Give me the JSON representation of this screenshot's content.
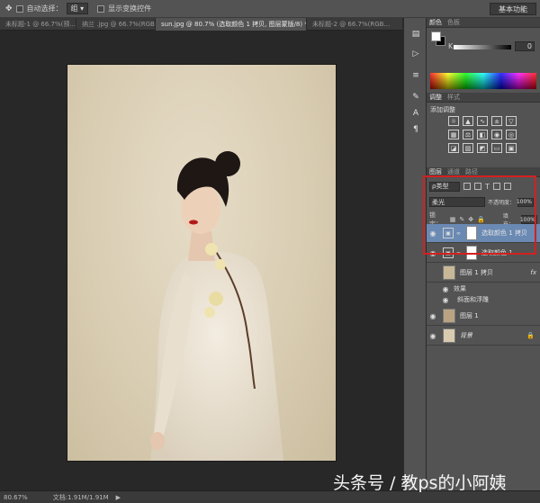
{
  "options_bar": {
    "auto_select_label": "自动选择：",
    "auto_select_value": "组",
    "show_transform_label": "显示变换控件",
    "workspace": "基本功能"
  },
  "tabs": [
    {
      "label": "未标题-1 @ 66.7%(预...",
      "active": false
    },
    {
      "label": "纳兰 .jpg @ 66.7%(RGB...",
      "active": false
    },
    {
      "label": "sun.jpg @ 80.7% (选取颜色 1 拷贝, 图层蒙版/8) *",
      "active": true
    },
    {
      "label": "未标题-2 @ 66.7%(RGB...",
      "active": false
    }
  ],
  "status": {
    "zoom": "80.67%",
    "doc": "文档:1.91M/1.91M"
  },
  "color_panel": {
    "tabs": [
      "颜色",
      "色板"
    ],
    "k_label": "K",
    "k_value": "0"
  },
  "adjustments_panel": {
    "tabs": [
      "调整",
      "样式"
    ],
    "title": "添加调整",
    "icons": [
      "brightness-icon",
      "levels-icon",
      "curves-icon",
      "exposure-icon",
      "triangle-icon",
      "vibrance-icon",
      "hue-icon",
      "colorbalance-icon",
      "bw-icon",
      "photofilter-icon",
      "channelmixer-icon",
      "lookup-icon",
      "invert-icon",
      "posterize-icon",
      "threshold-icon",
      "gradientmap-icon",
      "selectivecolor-icon"
    ]
  },
  "layers_panel": {
    "tabs": [
      "图层",
      "通道",
      "路径"
    ],
    "kind_label": "ρ类型",
    "blend_mode": "柔光",
    "opacity_label": "不透明度：",
    "opacity_value": "100%",
    "lock_label": "锁定：",
    "fill_label": "填充：",
    "fill_value": "100%",
    "layers": [
      {
        "name": "选取颜色 1 拷贝",
        "type": "adjustment",
        "selected": true
      },
      {
        "name": "选取颜色 1",
        "type": "adjustment",
        "selected": false
      },
      {
        "name": "图层 1 拷贝",
        "type": "pixel",
        "fx": "fx"
      },
      {
        "name": "效果",
        "type": "sub"
      },
      {
        "name": "斜面和浮雕",
        "type": "sub"
      },
      {
        "name": "图层 1",
        "type": "pixel"
      },
      {
        "name": "背景",
        "type": "background"
      }
    ]
  },
  "watermark": "头条号 / 教ps的小阿姨"
}
